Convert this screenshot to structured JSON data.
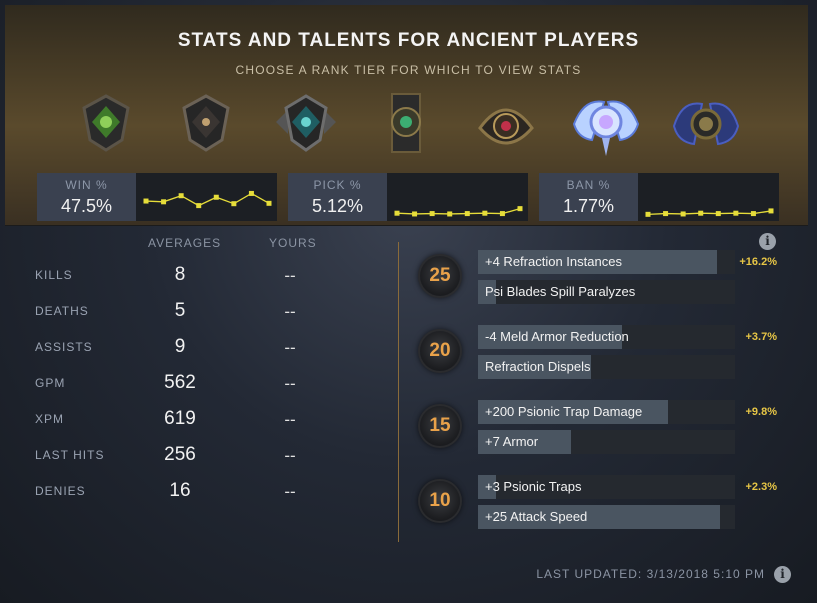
{
  "header": {
    "title": "STATS AND TALENTS FOR ANCIENT PLAYERS",
    "subtitle": "CHOOSE A RANK TIER FOR WHICH TO VIEW STATS"
  },
  "rank_tiers": [
    {
      "icon": "herald-medal-icon",
      "accent": "#5f8f3a"
    },
    {
      "icon": "guardian-medal-icon",
      "accent": "#7b6a55"
    },
    {
      "icon": "crusader-medal-icon",
      "accent": "#3aa0a0"
    },
    {
      "icon": "archon-medal-icon",
      "accent": "#3c8a5a"
    },
    {
      "icon": "legend-medal-icon",
      "accent": "#a03040"
    },
    {
      "icon": "ancient-medal-icon",
      "accent": "#8fb8ff",
      "selected": true
    },
    {
      "icon": "divine-medal-icon",
      "accent": "#3a4fa0"
    }
  ],
  "summary": {
    "win": {
      "label": "WIN %",
      "value": "47.5%",
      "trend": [
        0.42,
        0.4,
        0.56,
        0.3,
        0.52,
        0.35,
        0.62,
        0.36
      ]
    },
    "pick": {
      "label": "PICK %",
      "value": "5.12%",
      "trend": [
        0.1,
        0.08,
        0.09,
        0.08,
        0.09,
        0.1,
        0.09,
        0.22
      ]
    },
    "ban": {
      "label": "BAN %",
      "value": "1.77%",
      "trend": [
        0.07,
        0.09,
        0.08,
        0.1,
        0.09,
        0.1,
        0.09,
        0.16
      ]
    },
    "spark_color": "#e6dd3a"
  },
  "stats_table": {
    "col_averages": "AVERAGES",
    "col_yours": "YOURS",
    "rows": [
      {
        "label": "KILLS",
        "avg": "8",
        "yours": "--"
      },
      {
        "label": "DEATHS",
        "avg": "5",
        "yours": "--"
      },
      {
        "label": "ASSISTS",
        "avg": "9",
        "yours": "--"
      },
      {
        "label": "GPM",
        "avg": "562",
        "yours": "--"
      },
      {
        "label": "XPM",
        "avg": "619",
        "yours": "--"
      },
      {
        "label": "LAST HITS",
        "avg": "256",
        "yours": "--"
      },
      {
        "label": "DENIES",
        "avg": "16",
        "yours": "--"
      }
    ]
  },
  "talents": {
    "tiers": [
      {
        "level": "25",
        "top": {
          "label": "+4 Refraction Instances",
          "fill": 0.93
        },
        "bottom": {
          "label": "Psi Blades Spill Paralyzes",
          "fill": 0.07
        },
        "pct": "+16.2%"
      },
      {
        "level": "20",
        "top": {
          "label": "-4 Meld Armor Reduction",
          "fill": 0.56
        },
        "bottom": {
          "label": "Refraction Dispels",
          "fill": 0.44
        },
        "pct": "+3.7%"
      },
      {
        "level": "15",
        "top": {
          "label": "+200 Psionic Trap Damage",
          "fill": 0.74
        },
        "bottom": {
          "label": "+7 Armor",
          "fill": 0.36
        },
        "pct": "+9.8%"
      },
      {
        "level": "10",
        "top": {
          "label": "+3 Psionic Traps",
          "fill": 0.07
        },
        "bottom": {
          "label": "+25 Attack Speed",
          "fill": 0.94
        },
        "pct": "+2.3%"
      }
    ],
    "info_icon": "i"
  },
  "footer": {
    "last_updated": "LAST UPDATED: 3/13/2018 5:10 PM",
    "info_icon": "i"
  }
}
